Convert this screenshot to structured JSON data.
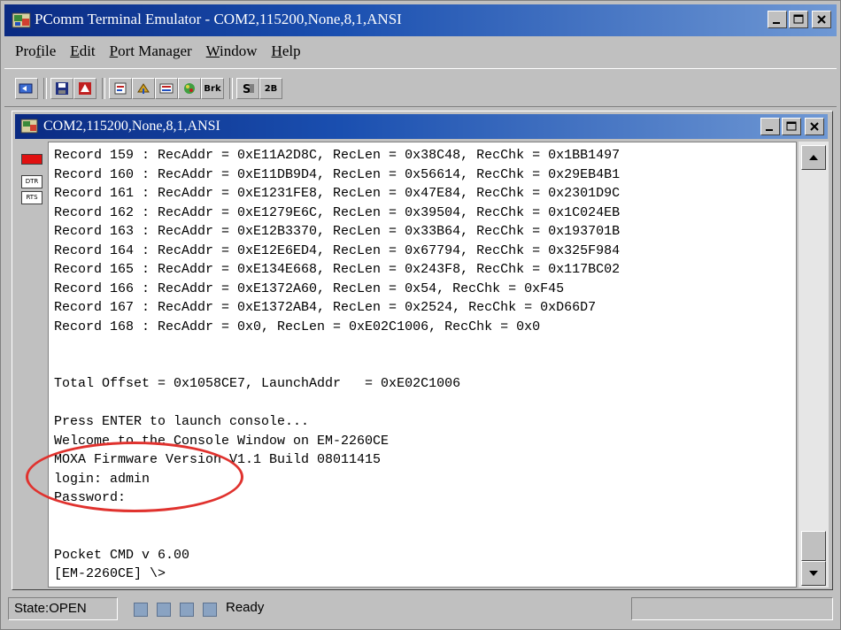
{
  "window": {
    "title": "PComm Terminal Emulator - COM2,115200,None,8,1,ANSI",
    "title_icon": "pcomm-app-icon",
    "controls": [
      "minimize",
      "maximize",
      "close"
    ]
  },
  "menu": [
    {
      "pre": "Pro",
      "key": "f",
      "post": "ile"
    },
    {
      "pre": "",
      "key": "E",
      "post": "dit"
    },
    {
      "pre": "",
      "key": "P",
      "post": "ort Manager"
    },
    {
      "pre": "",
      "key": "W",
      "post": "indow"
    },
    {
      "pre": "",
      "key": "H",
      "post": "elp"
    }
  ],
  "toolbar": {
    "icons": [
      "open-session-icon",
      "save-icon",
      "log-icon",
      "properties-icon",
      "transfer-icon",
      "script-icon",
      "color-icon",
      "break-icon",
      "terminal-icon",
      "2b-icon"
    ],
    "brk_label": "Brk",
    "twob_label": "2B"
  },
  "child_window": {
    "title": "COM2,115200,None,8,1,ANSI"
  },
  "side_panel": {
    "dtr_label": "DTR",
    "rts_label": "RTS"
  },
  "terminal": {
    "lines": [
      "Record 159 : RecAddr = 0xE11A2D8C, RecLen = 0x38C48, RecChk = 0x1BB1497",
      "Record 160 : RecAddr = 0xE11DB9D4, RecLen = 0x56614, RecChk = 0x29EB4B1",
      "Record 161 : RecAddr = 0xE1231FE8, RecLen = 0x47E84, RecChk = 0x2301D9C",
      "Record 162 : RecAddr = 0xE1279E6C, RecLen = 0x39504, RecChk = 0x1C024EB",
      "Record 163 : RecAddr = 0xE12B3370, RecLen = 0x33B64, RecChk = 0x193701B",
      "Record 164 : RecAddr = 0xE12E6ED4, RecLen = 0x67794, RecChk = 0x325F984",
      "Record 165 : RecAddr = 0xE134E668, RecLen = 0x243F8, RecChk = 0x117BC02",
      "Record 166 : RecAddr = 0xE1372A60, RecLen = 0x54, RecChk = 0xF45",
      "Record 167 : RecAddr = 0xE1372AB4, RecLen = 0x2524, RecChk = 0xD66D7",
      "Record 168 : RecAddr = 0x0, RecLen = 0xE02C1006, RecChk = 0x0",
      "",
      "",
      "Total Offset = 0x1058CE7, LaunchAddr   = 0xE02C1006",
      "",
      "Press ENTER to launch console...",
      "Welcome to the Console Window on EM-2260CE",
      "MOXA Firmware Version V1.1 Build 08011415",
      "login: admin",
      "Password:",
      "",
      "",
      "Pocket CMD v 6.00",
      "[EM-2260CE] \\>"
    ]
  },
  "status": {
    "state": "State:OPEN",
    "leds": [
      "CTS",
      "DSR",
      "RI",
      "DCD"
    ],
    "message": "Ready"
  },
  "colors": {
    "title_gradient_start": "#0a2a82",
    "title_gradient_end": "#6f98d4",
    "highlight_oval": "#e0322e"
  }
}
